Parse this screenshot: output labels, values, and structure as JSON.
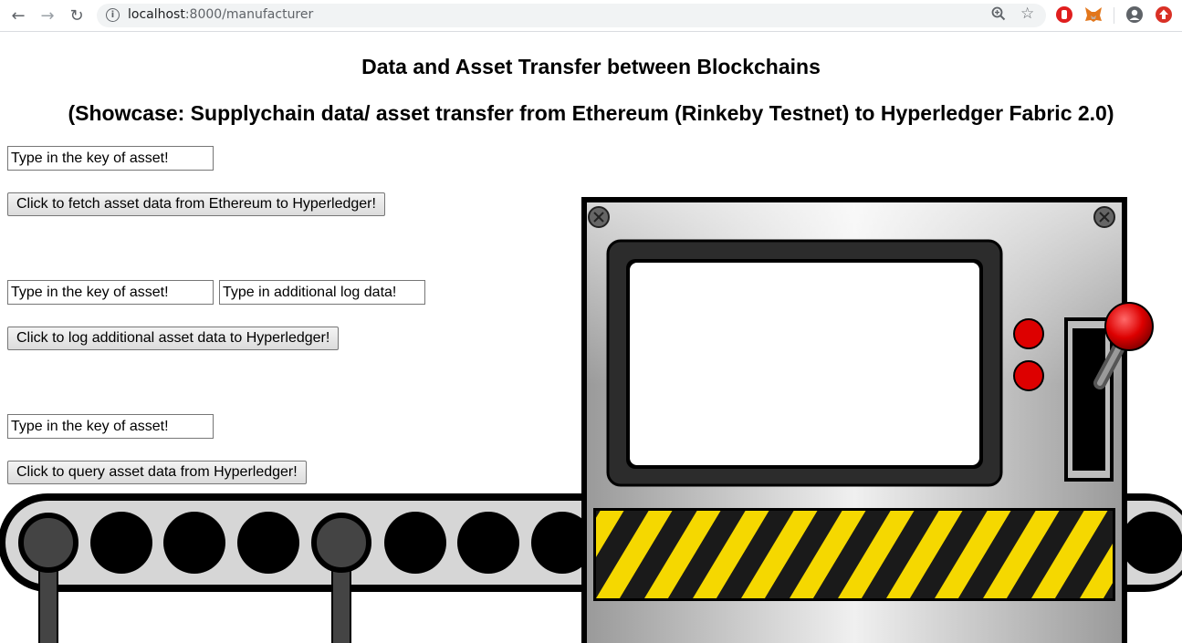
{
  "browser": {
    "url_host": "localhost",
    "url_path": ":8000/manufacturer",
    "nav": {
      "back": "←",
      "forward": "→",
      "reload": "↻"
    },
    "icons": [
      "info-icon",
      "zoom-icon",
      "star-icon",
      "extension-icon",
      "metamask-icon",
      "profile-icon",
      "update-icon"
    ]
  },
  "page": {
    "title": "Data and Asset Transfer between Blockchains",
    "subtitle": "(Showcase: Supplychain data/ asset transfer from Ethereum (Rinkeby Testnet) to Hyperledger Fabric 2.0)",
    "fetch_section": {
      "key_placeholder": "Type in the key of asset!",
      "button": "Click to fetch asset data from Ethereum to Hyperledger!"
    },
    "log_section": {
      "key_placeholder": "Type in the key of asset!",
      "log_placeholder": "Type in additional log data!",
      "button": "Click to log additional asset data to Hyperledger!"
    },
    "query_section": {
      "key_placeholder": "Type in the key of asset!",
      "button": "Click to query asset data from Hyperledger!"
    }
  },
  "illustration": {
    "name": "factory-machine-with-conveyor-belt",
    "colors": {
      "stripe_yellow": "#f5d800",
      "stripe_black": "#1a1a1a",
      "button_red": "#dd0000",
      "body_gray": "#c8c8c8"
    }
  }
}
